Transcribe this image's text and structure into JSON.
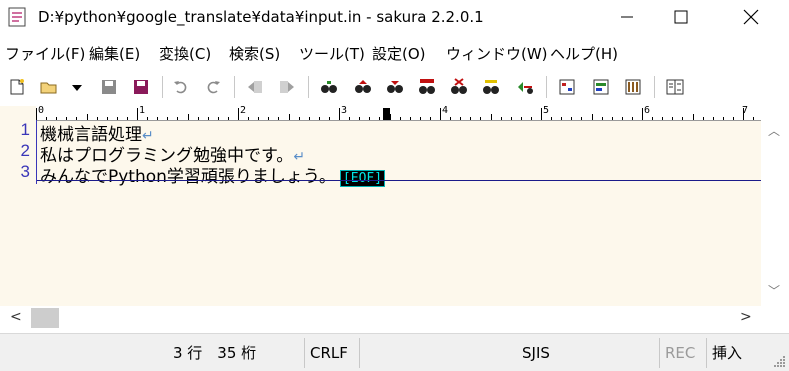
{
  "window": {
    "title": "D:¥python¥google_translate¥data¥input.in - sakura 2.2.0.1"
  },
  "menu": [
    {
      "label": "ファイル(F)"
    },
    {
      "label": "編集(E)"
    },
    {
      "label": "変換(C)"
    },
    {
      "label": "検索(S)"
    },
    {
      "label": "ツール(T)"
    },
    {
      "label": "設定(O)"
    },
    {
      "label": "ウィンドウ(W)"
    },
    {
      "label": "ヘルプ(H)"
    }
  ],
  "toolbar": {
    "icons": [
      "new-file-icon",
      "open-file-icon",
      "open-dropdown-icon",
      "save-icon",
      "save-all-icon",
      "undo-icon",
      "redo-icon",
      "jump-back-icon",
      "jump-forward-icon",
      "search-icon",
      "search-prev-icon",
      "search-next-icon",
      "replace-icon",
      "search-clear-icon",
      "grep-icon",
      "bookmark-jump-icon",
      "outline-icon",
      "type-settings-icon",
      "common-settings-icon",
      "compare-icon"
    ]
  },
  "ruler": {
    "labels": [
      "0",
      "1",
      "2",
      "3",
      "4",
      "5",
      "6",
      "7"
    ]
  },
  "editor": {
    "lines": [
      {
        "number": "1",
        "text": "機械言語処理",
        "eol": "↵"
      },
      {
        "number": "2",
        "text": "私はプログラミング勉強中です。",
        "eol": "↵"
      },
      {
        "number": "3",
        "text": "みんなでPython学習頑張りましょう。",
        "eol": ""
      }
    ],
    "eof_marker": "[EOF]",
    "background_color": "#fdf8ec",
    "line_number_color": "#3a36b8"
  },
  "status": {
    "position": "3 行　35 桁",
    "line_ending": "CRLF",
    "encoding": "SJIS",
    "rec": "REC",
    "mode": "挿入"
  }
}
